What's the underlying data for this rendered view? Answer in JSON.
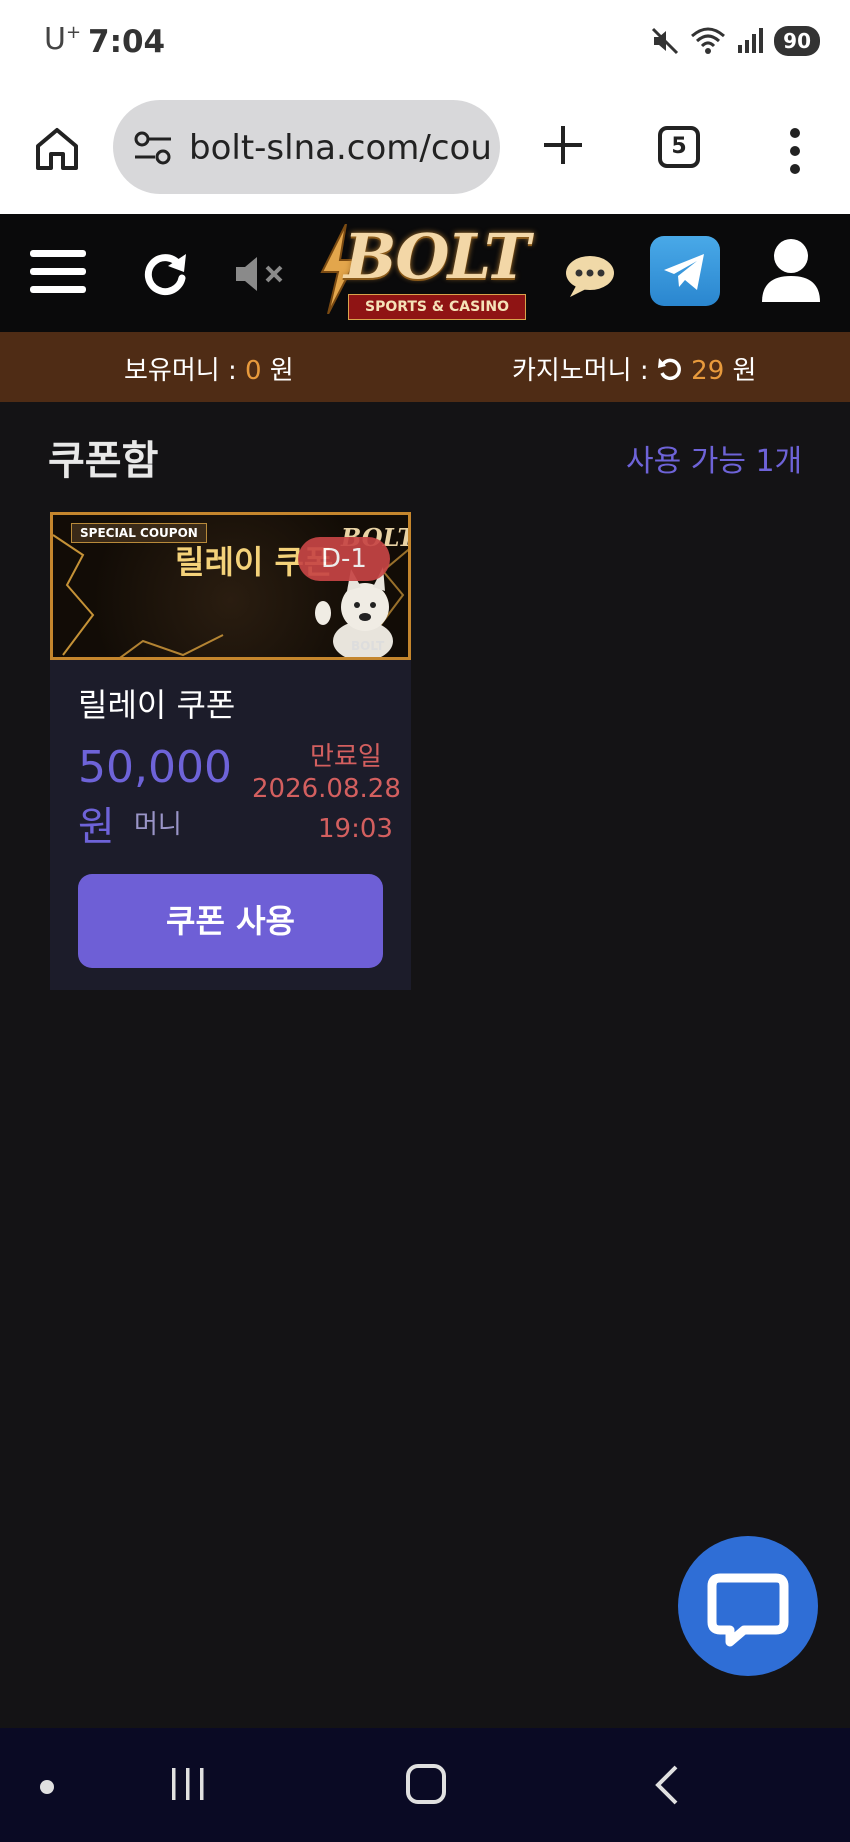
{
  "status_bar": {
    "carrier": "U",
    "carrier_sup": "+",
    "time": "7:04",
    "battery": "90"
  },
  "browser": {
    "url": "bolt-slna.com/cou",
    "tab_count": "5"
  },
  "site_header": {
    "logo_text": "BOLT",
    "logo_sub": "SPORTS & CASINO"
  },
  "balance": {
    "holding_label": "보유머니 : ",
    "holding_value": "0",
    "holding_unit": " 원",
    "casino_label": "카지노머니 : ",
    "casino_value": "29",
    "casino_unit": " 원"
  },
  "coupon_box": {
    "title": "쿠폰함",
    "available_text": "사용 가능 1개",
    "card": {
      "banner_special": "SPECIAL COUPON",
      "banner_title": "릴레이 쿠폰",
      "banner_brand": "BOLT",
      "banner_brand_small": "BOLT",
      "dday": "D-1",
      "name": "릴레이 쿠폰",
      "amount": "50,000",
      "amount_unit": "원",
      "money_label": "머니",
      "expiry_label": "만료일",
      "expiry_date": "2026.08.28",
      "expiry_time": "19:03",
      "use_button": "쿠폰 사용"
    }
  },
  "colors": {
    "accent": "#6e63d8",
    "expiry": "#d35f5f",
    "balance_bar": "#4f2c15",
    "fab": "#2f6ed6"
  }
}
